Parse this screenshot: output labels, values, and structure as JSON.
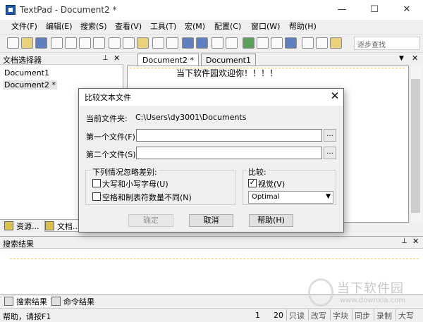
{
  "window": {
    "title": "TextPad - Document2 *"
  },
  "controls": {
    "min": "—",
    "max": "☐",
    "close": "✕"
  },
  "menu": [
    "文件(F)",
    "编辑(E)",
    "搜索(S)",
    "查看(V)",
    "工具(T)",
    "宏(M)",
    "配置(C)",
    "窗口(W)",
    "帮助(H)"
  ],
  "toolbar": {
    "step_search": "逐步查找"
  },
  "left_panel": {
    "title": "文档选择器",
    "documents": [
      "Document1",
      "Document2 *"
    ],
    "tabs": [
      "资源...",
      "文档..."
    ]
  },
  "editor": {
    "tabs": [
      "Document2 *",
      "Document1"
    ],
    "content": "当下软件园欢迎你！！！！"
  },
  "search_results": {
    "title": "搜索结果",
    "tabs": [
      "搜索结果",
      "命令结果"
    ]
  },
  "status": {
    "help": "帮助，请按F1",
    "line": "1",
    "col": "20",
    "indicators": [
      "只读",
      "改写",
      "字块",
      "同步",
      "录制",
      "大写"
    ]
  },
  "dialog": {
    "title": "比较文本文件",
    "current_folder_label": "当前文件夹:",
    "current_folder": "C:\\Users\\dy3001\\Documents",
    "file1_label": "第一个文件(F):",
    "file2_label": "第二个文件(S):",
    "file1_value": "",
    "file2_value": "",
    "browse": "...",
    "ignore_group": "下列情况忽略差别:",
    "ignore_case": "大写和小写字母(U)",
    "ignore_whitespace": "空格和制表符数量不同(N)",
    "compare_group": "比较:",
    "visual": "视觉(V)",
    "visual_checked": true,
    "mode": "Optimal",
    "ok": "确定",
    "cancel": "取消",
    "help": "帮助(H)"
  },
  "watermark": {
    "text": "当下软件园",
    "sub": "www.downxia.com"
  }
}
